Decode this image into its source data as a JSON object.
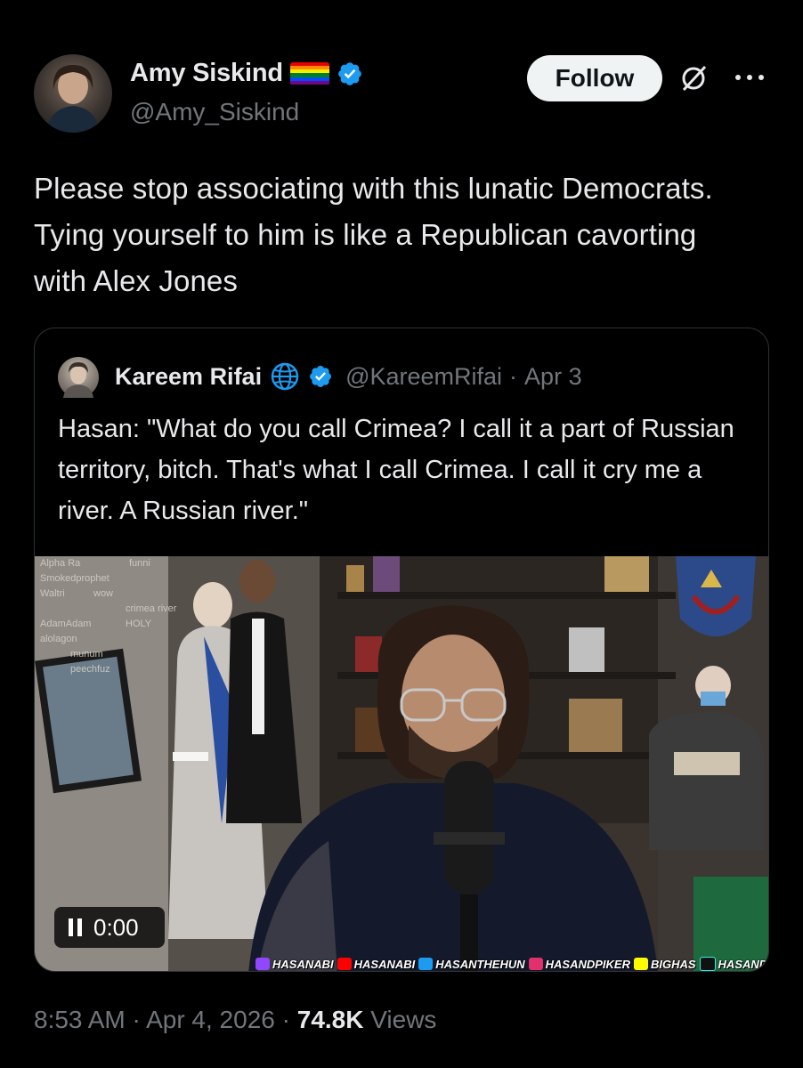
{
  "author": {
    "name": "Amy Siskind",
    "handle": "@Amy_Siskind"
  },
  "follow_label": "Follow",
  "tweet_text": "Please stop associating with this lunatic Democrats. Tying yourself to him is like a Republican cavorting with Alex Jones",
  "quote": {
    "name": "Kareem Rifai",
    "handle": "@KareemRifai",
    "separator": "·",
    "date": "Apr 3",
    "text": "Hasan: \"What do you call Crimea? I call it a part of Russian territory, bitch. That's what I call Crimea. I call it cry me a river. A Russian river.\"",
    "video": {
      "time": "0:00",
      "progress": 0,
      "chat": [
        "Alpha Ra",
        "funni",
        "Smokedprophet",
        "Waltri",
        "wow",
        "crimea river",
        "AdamAdam",
        "HOLY",
        "alolagon",
        "munum",
        "peechfuz"
      ],
      "socials": [
        "HASANABI",
        "HASANABI",
        "HASANTHEHUN",
        "HASANDPIKER",
        "BIGHAS",
        "HASANDPIKE"
      ]
    }
  },
  "footer": {
    "time": "8:53 AM",
    "sep1": "·",
    "date": "Apr 4, 2026",
    "sep2": "·",
    "views_count": "74.8K",
    "views_label": "Views"
  },
  "colors": {
    "background": "#000000",
    "verified": "#1d9bf0",
    "secondary_text": "#71767b",
    "follow_bg": "#eff3f4"
  },
  "icons": [
    "verified-badge-icon",
    "pride-flag-icon",
    "grok-icon",
    "more-icon",
    "globe-icon",
    "pause-icon"
  ]
}
